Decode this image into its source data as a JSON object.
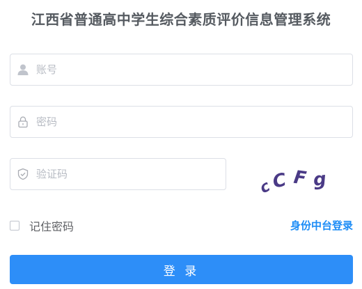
{
  "title": "江西省普通高中学生综合素质评价信息管理系统",
  "form": {
    "username": {
      "placeholder": "账号",
      "value": "",
      "icon": "user-icon"
    },
    "password": {
      "placeholder": "密码",
      "value": "",
      "icon": "lock-icon"
    },
    "captcha_input": {
      "placeholder": "验证码",
      "value": "",
      "icon": "shield-icon"
    },
    "captcha_image": {
      "text": "cCFg",
      "color": "#4a3a86"
    },
    "remember": {
      "label": "记住密码",
      "checked": false
    },
    "id_platform_link": "身份中台登录",
    "login_button": "登 录"
  },
  "colors": {
    "primary": "#2d8ef8",
    "link": "#1c8cf6",
    "title": "#555a60",
    "border": "#dcdfe6",
    "placeholder": "#b8bcc4"
  }
}
